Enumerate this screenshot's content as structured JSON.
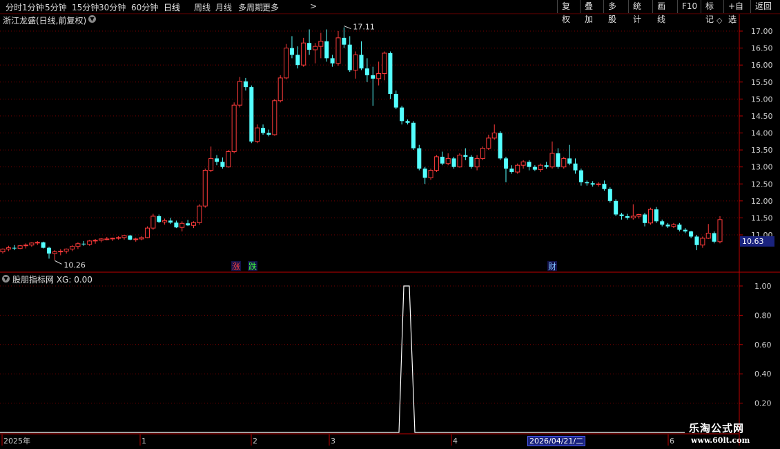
{
  "toolbar": {
    "periods": [
      "分时",
      "1分钟",
      "5分钟",
      "15分钟",
      "30分钟",
      "60分钟",
      "日线",
      "周线",
      "月线",
      "多周期",
      "更多"
    ],
    "active_period": "日线",
    "more_arrow": ">",
    "right_buttons": [
      "复权",
      "叠加",
      "多股",
      "统计",
      "画线",
      "F10",
      "标记",
      "+自选",
      "返回"
    ]
  },
  "chart": {
    "title": "浙江龙盛(日线,前复权)",
    "max_label": "17.11",
    "min_label": "10.26",
    "current_price": "10.63",
    "y_ticks": [
      "17.00",
      "16.50",
      "16.00",
      "15.50",
      "15.00",
      "14.50",
      "14.00",
      "13.50",
      "13.00",
      "12.50",
      "12.00",
      "11.50",
      "11.00"
    ],
    "markers": [
      {
        "text": "涨",
        "color": "#ff4040"
      },
      {
        "text": "跌",
        "color": "#40ff40"
      },
      {
        "text": "财",
        "color": "#80c0ff"
      }
    ]
  },
  "indicator": {
    "title": "股朋指标网  XG: 0.00",
    "y_ticks": [
      "1.00",
      "0.80",
      "0.60",
      "0.40",
      "0.20"
    ],
    "series_values": [
      0,
      1,
      1,
      0
    ],
    "series_label": "XG"
  },
  "timeline": {
    "labels": [
      "2025年",
      "1",
      "2",
      "3",
      "4",
      "6"
    ],
    "cursor_date": "2026/04/21/二"
  },
  "watermark": {
    "line1": "乐淘公式网",
    "line2": "www.60lt.com"
  },
  "colors": {
    "up": "#ff3b3b",
    "down": "#54ffff",
    "grid": "#7a0000",
    "axis": "#c00000",
    "accent": "#1a237e"
  },
  "chart_data": {
    "type": "candlestick",
    "title": "浙江龙盛(日线,前复权)",
    "x_start_label": "2025年",
    "ylim": [
      10.0,
      17.1
    ],
    "min_price": 10.26,
    "max_price": 17.11,
    "last_price": 10.63,
    "ohlc": [
      [
        10.5,
        10.6,
        10.45,
        10.58
      ],
      [
        10.58,
        10.68,
        10.52,
        10.62
      ],
      [
        10.62,
        10.7,
        10.55,
        10.6
      ],
      [
        10.6,
        10.7,
        10.58,
        10.68
      ],
      [
        10.68,
        10.75,
        10.6,
        10.7
      ],
      [
        10.7,
        10.78,
        10.65,
        10.76
      ],
      [
        10.76,
        10.82,
        10.7,
        10.78
      ],
      [
        10.78,
        10.8,
        10.6,
        10.62
      ],
      [
        10.62,
        10.65,
        10.3,
        10.45
      ],
      [
        10.45,
        10.55,
        10.26,
        10.5
      ],
      [
        10.5,
        10.58,
        10.4,
        10.52
      ],
      [
        10.52,
        10.6,
        10.45,
        10.58
      ],
      [
        10.58,
        10.7,
        10.52,
        10.66
      ],
      [
        10.66,
        10.78,
        10.58,
        10.74
      ],
      [
        10.74,
        10.82,
        10.68,
        10.72
      ],
      [
        10.72,
        10.85,
        10.68,
        10.82
      ],
      [
        10.82,
        10.88,
        10.74,
        10.84
      ],
      [
        10.84,
        10.9,
        10.78,
        10.88
      ],
      [
        10.88,
        10.94,
        10.84,
        10.88
      ],
      [
        10.88,
        10.92,
        10.82,
        10.9
      ],
      [
        10.9,
        10.96,
        10.86,
        10.92
      ],
      [
        10.92,
        11.0,
        10.86,
        10.98
      ],
      [
        10.98,
        11.0,
        10.84,
        10.86
      ],
      [
        10.86,
        10.92,
        10.8,
        10.88
      ],
      [
        10.88,
        10.96,
        10.84,
        10.92
      ],
      [
        10.92,
        11.25,
        10.9,
        11.2
      ],
      [
        11.2,
        11.62,
        11.15,
        11.55
      ],
      [
        11.55,
        11.6,
        11.35,
        11.38
      ],
      [
        11.38,
        11.48,
        11.3,
        11.42
      ],
      [
        11.42,
        11.5,
        11.32,
        11.36
      ],
      [
        11.36,
        11.42,
        11.2,
        11.22
      ],
      [
        11.22,
        11.4,
        11.1,
        11.34
      ],
      [
        11.34,
        11.44,
        11.26,
        11.28
      ],
      [
        11.28,
        11.4,
        11.2,
        11.36
      ],
      [
        11.36,
        11.9,
        11.3,
        11.85
      ],
      [
        11.85,
        12.95,
        11.8,
        12.9
      ],
      [
        12.9,
        13.6,
        12.85,
        13.25
      ],
      [
        13.25,
        13.35,
        13.05,
        13.15
      ],
      [
        13.15,
        13.28,
        12.95,
        13.0
      ],
      [
        13.0,
        13.5,
        12.98,
        13.45
      ],
      [
        13.45,
        14.9,
        13.4,
        14.82
      ],
      [
        14.82,
        15.65,
        14.75,
        15.52
      ],
      [
        15.52,
        15.62,
        15.25,
        15.35
      ],
      [
        15.35,
        15.4,
        13.7,
        13.75
      ],
      [
        13.75,
        14.25,
        13.7,
        14.15
      ],
      [
        14.15,
        14.25,
        13.95,
        14.0
      ],
      [
        14.0,
        14.1,
        13.9,
        13.95
      ],
      [
        13.95,
        15.0,
        13.92,
        14.95
      ],
      [
        14.95,
        15.7,
        14.9,
        15.62
      ],
      [
        15.62,
        16.62,
        15.58,
        16.5
      ],
      [
        16.5,
        16.85,
        16.2,
        16.3
      ],
      [
        16.3,
        16.55,
        15.9,
        16.0
      ],
      [
        16.0,
        16.8,
        15.95,
        16.65
      ],
      [
        16.65,
        17.05,
        16.3,
        16.45
      ],
      [
        16.45,
        16.65,
        16.05,
        16.55
      ],
      [
        16.55,
        16.95,
        16.2,
        16.7
      ],
      [
        16.7,
        17.05,
        16.1,
        16.2
      ],
      [
        16.2,
        16.3,
        15.95,
        16.05
      ],
      [
        16.05,
        17.0,
        15.98,
        16.8
      ],
      [
        16.8,
        17.11,
        16.5,
        16.6
      ],
      [
        16.6,
        16.85,
        15.8,
        15.85
      ],
      [
        15.85,
        16.4,
        15.6,
        16.3
      ],
      [
        16.3,
        16.7,
        15.85,
        15.9
      ],
      [
        15.9,
        16.2,
        15.5,
        15.7
      ],
      [
        15.7,
        15.95,
        14.8,
        15.6
      ],
      [
        15.6,
        16.1,
        15.4,
        15.75
      ],
      [
        15.75,
        16.4,
        15.55,
        16.35
      ],
      [
        16.35,
        16.4,
        15.0,
        15.15
      ],
      [
        15.15,
        15.25,
        14.7,
        14.75
      ],
      [
        14.75,
        14.8,
        14.25,
        14.35
      ],
      [
        14.35,
        14.4,
        14.25,
        14.3
      ],
      [
        14.3,
        14.35,
        13.5,
        13.55
      ],
      [
        13.55,
        13.65,
        12.9,
        12.95
      ],
      [
        12.95,
        13.0,
        12.5,
        12.68
      ],
      [
        12.68,
        12.95,
        12.62,
        12.9
      ],
      [
        12.9,
        13.35,
        12.85,
        13.3
      ],
      [
        13.3,
        13.45,
        13.05,
        13.1
      ],
      [
        13.1,
        13.4,
        13.05,
        13.25
      ],
      [
        13.25,
        13.3,
        12.95,
        13.0
      ],
      [
        13.0,
        13.4,
        12.98,
        13.35
      ],
      [
        13.35,
        13.55,
        13.2,
        13.3
      ],
      [
        13.3,
        13.35,
        12.95,
        13.0
      ],
      [
        13.0,
        13.35,
        12.9,
        13.25
      ],
      [
        13.25,
        13.6,
        13.2,
        13.55
      ],
      [
        13.55,
        13.95,
        13.5,
        13.85
      ],
      [
        13.85,
        14.25,
        13.8,
        14.0
      ],
      [
        14.0,
        14.05,
        13.2,
        13.25
      ],
      [
        13.25,
        13.3,
        12.55,
        12.95
      ],
      [
        12.95,
        13.05,
        12.8,
        12.85
      ],
      [
        12.85,
        13.1,
        12.8,
        13.05
      ],
      [
        13.05,
        13.2,
        12.95,
        13.15
      ],
      [
        13.15,
        13.2,
        12.9,
        13.0
      ],
      [
        13.0,
        13.05,
        12.88,
        12.92
      ],
      [
        12.92,
        13.1,
        12.85,
        13.05
      ],
      [
        13.05,
        13.15,
        12.95,
        13.0
      ],
      [
        13.0,
        13.75,
        12.95,
        13.4
      ],
      [
        13.4,
        13.55,
        12.95,
        13.0
      ],
      [
        13.0,
        13.3,
        12.95,
        13.25
      ],
      [
        13.25,
        13.65,
        13.05,
        13.1
      ],
      [
        13.1,
        13.25,
        12.8,
        12.9
      ],
      [
        12.9,
        12.95,
        12.45,
        12.55
      ],
      [
        12.55,
        12.6,
        12.45,
        12.52
      ],
      [
        12.52,
        12.58,
        12.42,
        12.48
      ],
      [
        12.48,
        12.55,
        12.42,
        12.5
      ],
      [
        12.5,
        12.6,
        12.3,
        12.35
      ],
      [
        12.35,
        12.4,
        11.95,
        12.0
      ],
      [
        12.0,
        12.05,
        11.55,
        11.6
      ],
      [
        11.6,
        11.65,
        11.45,
        11.55
      ],
      [
        11.55,
        11.62,
        11.45,
        11.5
      ],
      [
        11.5,
        11.9,
        11.45,
        11.55
      ],
      [
        11.55,
        11.62,
        11.48,
        11.6
      ],
      [
        11.6,
        11.65,
        11.25,
        11.35
      ],
      [
        11.35,
        11.8,
        11.3,
        11.75
      ],
      [
        11.75,
        11.82,
        11.35,
        11.4
      ],
      [
        11.4,
        11.45,
        11.25,
        11.3
      ],
      [
        11.3,
        11.35,
        11.2,
        11.25
      ],
      [
        11.25,
        11.35,
        11.2,
        11.3
      ],
      [
        11.3,
        11.35,
        11.1,
        11.15
      ],
      [
        11.15,
        11.2,
        11.05,
        11.1
      ],
      [
        11.1,
        11.12,
        10.9,
        10.95
      ],
      [
        10.95,
        11.0,
        10.55,
        10.7
      ],
      [
        10.7,
        10.95,
        10.62,
        10.9
      ],
      [
        10.9,
        11.32,
        10.88,
        11.05
      ],
      [
        11.05,
        11.1,
        10.75,
        10.8
      ],
      [
        10.8,
        11.55,
        10.75,
        11.45
      ]
    ],
    "indicator_series": {
      "name": "XG",
      "spike_value": 1.0,
      "baseline": 0.0
    }
  }
}
